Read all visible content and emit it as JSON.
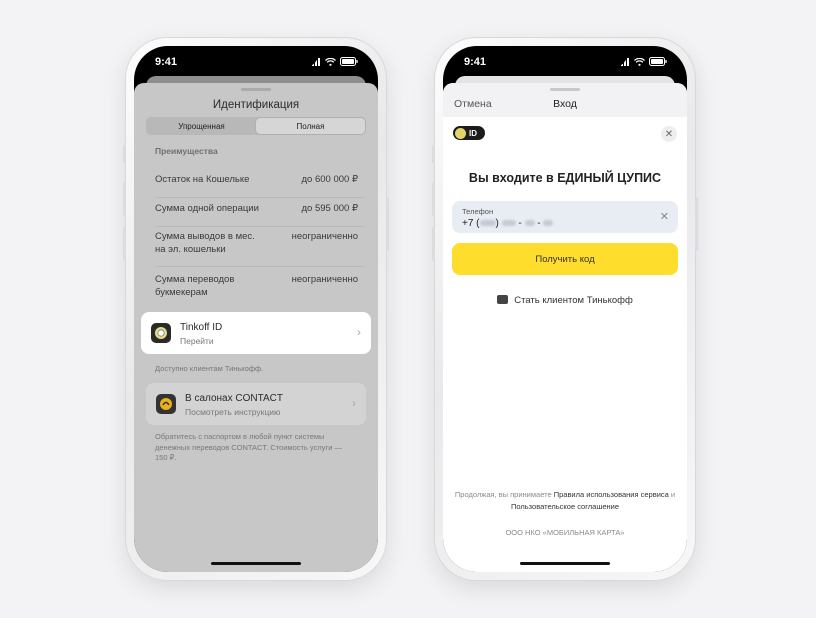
{
  "status_bar": {
    "time": "9:41"
  },
  "left": {
    "title": "Идентификация",
    "segments": [
      "Упрощенная",
      "Полная"
    ],
    "section_header": "Преимущества",
    "rows": [
      {
        "label": "Остаток на Кошельке",
        "value": "до 600 000 ₽"
      },
      {
        "label": "Сумма одной операции",
        "value": "до 595 000 ₽"
      },
      {
        "label_line1": "Сумма выводов в мес.",
        "label_line2": "на эл. кошельки",
        "value": "неограниченно"
      },
      {
        "label_line1": "Сумма переводов",
        "label_line2": "букмекерам",
        "value": "неограниченно"
      }
    ],
    "tinkoff_card": {
      "title": "Tinkoff ID",
      "subtitle": "Перейти",
      "icon": "tinkoff-emblem-icon"
    },
    "tinkoff_note": "Доступно клиентам Тинькофф.",
    "contact_card": {
      "title": "В салонах CONTACT",
      "subtitle": "Посмотреть инструкцию",
      "icon": "contact-logo-icon"
    },
    "contact_note_lines": [
      "Обратитесь с паспортом в любой пункт системы",
      "денежных переводов CONTACT. Стоимость услуги —",
      "150 ₽."
    ]
  },
  "right": {
    "nav": {
      "cancel": "Отмена",
      "title": "Вход"
    },
    "badge_text": "ID",
    "heading": "Вы входите в ЕДИНЫЙ ЦУПИС",
    "phone_field": {
      "label": "Телефон",
      "prefix": "+7 ("
    },
    "submit_label": "Получить код",
    "become_client": "Стать клиентом Тинькофф",
    "terms_line1_prefix": "Продолжая, вы принимаете ",
    "terms_link1": "Правила использования сервиса",
    "terms_line1_suffix": " и",
    "terms_link2": "Пользовательское соглашение",
    "org": "ООО НКО «МОБИЛЬНАЯ КАРТА»"
  },
  "colors": {
    "accent_yellow": "#ffdd2d",
    "field_bg": "#e8ecf3",
    "overlay_gray": "#c7c7c7"
  }
}
